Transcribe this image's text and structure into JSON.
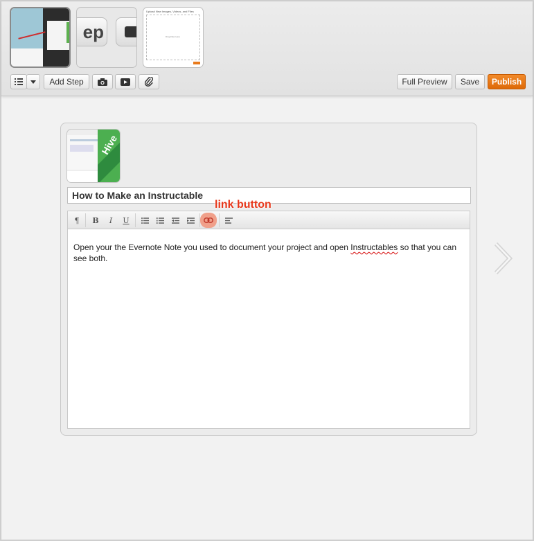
{
  "toolbar": {
    "add_step_label": "Add Step",
    "full_preview_label": "Full Preview",
    "save_label": "Save",
    "publish_label": "Publish",
    "publish_color": "#e87a1c",
    "icons": [
      "list-icon",
      "dropdown-caret-icon",
      "camera-icon",
      "video-icon",
      "paperclip-icon"
    ]
  },
  "thumbnails": {
    "t2_text": "ep",
    "t3_header": "Upload New Images, Videos, and Files",
    "t3_center": "Drag Files Here"
  },
  "step_thumb_text": "Hive",
  "editor": {
    "title": "How to Make an Instructable",
    "annotation": "link button",
    "annotation_color": "#e8371a",
    "body_before": "Open your the Evernote Note you used to document your project and open ",
    "body_misspelled": "Instructables",
    "body_after": " so that you can see both.",
    "format_icons": [
      "paragraph-icon",
      "bold-icon",
      "italic-icon",
      "underline-icon",
      "bullet-list-icon",
      "numbered-list-icon",
      "outdent-icon",
      "indent-icon",
      "link-icon",
      "align-icon"
    ],
    "format_labels": {
      "bold": "B",
      "italic": "I",
      "underline": "U",
      "paragraph": "¶"
    }
  }
}
